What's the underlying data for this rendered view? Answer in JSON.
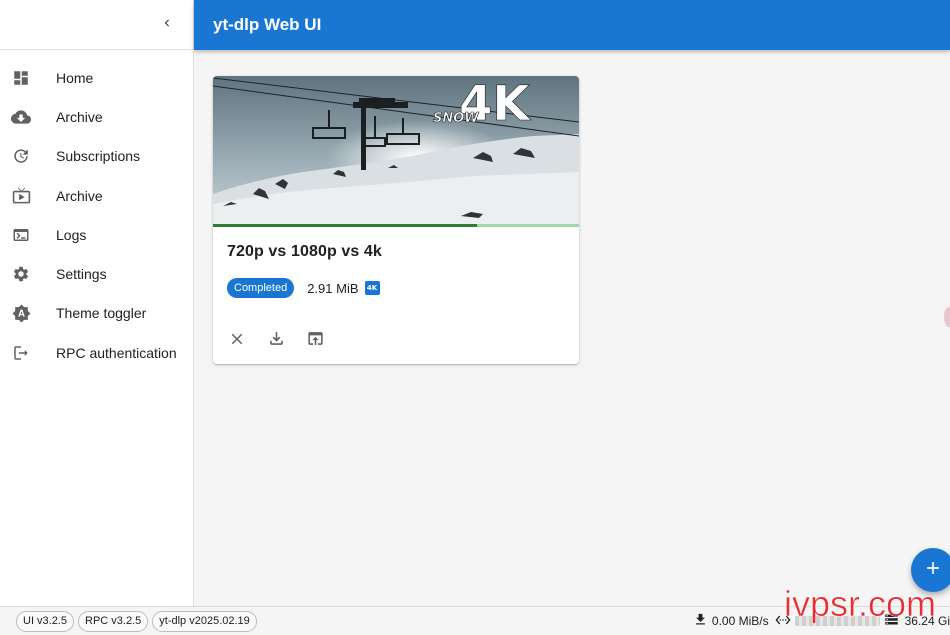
{
  "app": {
    "title": "yt-dlp Web UI"
  },
  "sidebar": {
    "collapse_icon": "chevron-left-icon",
    "items": [
      {
        "label": "Home",
        "icon": "dashboard-icon"
      },
      {
        "label": "Archive",
        "icon": "cloud-download-icon"
      },
      {
        "label": "Subscriptions",
        "icon": "update-icon"
      },
      {
        "label": "Archive",
        "icon": "live-tv-icon"
      },
      {
        "label": "Logs",
        "icon": "terminal-icon"
      },
      {
        "label": "Settings",
        "icon": "gear-icon"
      },
      {
        "label": "Theme toggler",
        "icon": "brightness-auto-icon"
      },
      {
        "label": "RPC authentication",
        "icon": "logout-icon"
      }
    ]
  },
  "download_card": {
    "title": "720p vs 1080p vs 4k",
    "status": "Completed",
    "size": "2.91 MiB",
    "quality_badge": "4K",
    "thumbnail_text": {
      "big": "4K",
      "small": "SNOW"
    },
    "progress_percent": 72,
    "actions": [
      {
        "icon": "close-icon",
        "name": "remove"
      },
      {
        "icon": "download-icon",
        "name": "download"
      },
      {
        "icon": "open-in-browser-icon",
        "name": "open"
      }
    ]
  },
  "fab": {
    "icon": "plus-icon"
  },
  "footer": {
    "versions": [
      "UI v3.2.5",
      "RPC v3.2.5",
      "yt-dlp v2025.02.19"
    ],
    "download_speed": "0.00 MiB/s",
    "disk_free": "36.24 Gi"
  },
  "watermark": "ivpsr.com",
  "colors": {
    "primary": "#1976d2",
    "progress": "#2e7d32",
    "watermark": "#e8242a"
  }
}
